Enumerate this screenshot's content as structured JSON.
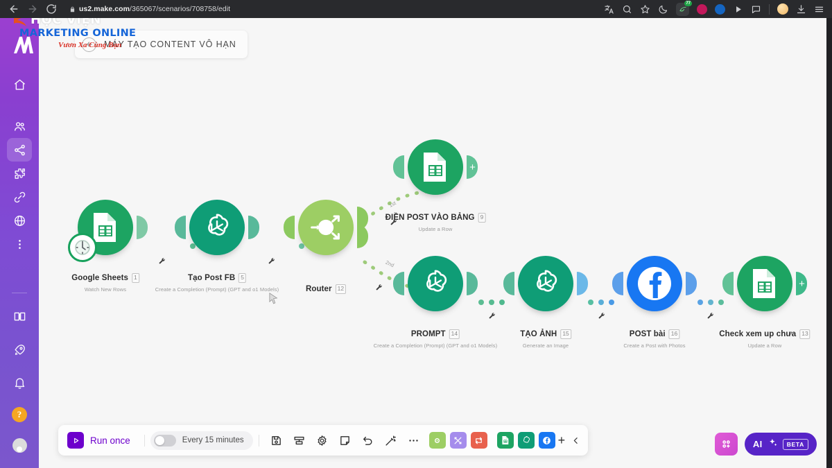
{
  "browser": {
    "url_host": "us2.make.com",
    "url_path": "/365067/scenarios/708758/edit",
    "icons": {
      "back": "back-arrow-icon",
      "forward": "forward-arrow-icon",
      "reload": "reload-icon",
      "lock": "lock-icon",
      "translate": "translate-icon",
      "zoom": "page-zoom-icon",
      "bookmark": "star-icon",
      "dark_mode": "moon-icon",
      "extension_green": "extension-green-icon",
      "extension_pink": "extension-pink-icon",
      "extension_blue": "extension-blue-icon",
      "media": "play-icon",
      "chat": "speech-bubble-icon",
      "profile": "profile-avatar-icon",
      "downloads": "download-icon",
      "menu": "hamburger-menu-icon"
    },
    "extension_badge": "77"
  },
  "watermark": {
    "line1": "HỌC VIỆN",
    "line2": "MARKETING ONLINE",
    "line3": "Vươn Xa Cùng Bạn"
  },
  "sidebar": {
    "items": [
      {
        "name": "home",
        "icon": "home-icon",
        "active": false
      },
      {
        "name": "team",
        "icon": "people-icon",
        "active": false
      },
      {
        "name": "scenarios",
        "icon": "share-nodes-icon",
        "active": true
      },
      {
        "name": "templates",
        "icon": "puzzle-icon",
        "active": false
      },
      {
        "name": "connections",
        "icon": "link-icon",
        "active": false
      },
      {
        "name": "webhooks",
        "icon": "globe-icon",
        "active": false
      },
      {
        "name": "more",
        "icon": "more-vertical-icon",
        "active": false
      }
    ],
    "bottom_items": [
      {
        "name": "docs",
        "icon": "book-icon"
      },
      {
        "name": "whats-new",
        "icon": "rocket-icon"
      },
      {
        "name": "notifications",
        "icon": "bell-icon"
      },
      {
        "name": "help",
        "icon": "question-mark-icon",
        "label": "?"
      },
      {
        "name": "account",
        "icon": "user-avatar-icon"
      }
    ]
  },
  "header": {
    "back_label": "back-arrow-icon",
    "scenario_title": "MÁY TẠO CONTENT VÔ HẠN"
  },
  "flow": {
    "modules": [
      {
        "id": "google-sheets",
        "name": "Google Sheets",
        "number": "1",
        "subtitle": "Watch New Rows",
        "app": "google-sheets",
        "color": "#1da462",
        "trigger": true,
        "trigger_icon": "clock-icon"
      },
      {
        "id": "tao-post-fb",
        "name": "Tạo Post FB",
        "number": "5",
        "subtitle": "Create a Completion (Prompt) (GPT and o1 Models)",
        "app": "openai",
        "color": "#0f9d76"
      },
      {
        "id": "router",
        "name": "Router",
        "number": "12",
        "subtitle": "",
        "app": "router",
        "color": "#9dce64"
      },
      {
        "id": "dien-post-vao-bang",
        "name": "ĐIỀN POST VÀO BẢNG",
        "number": "9",
        "subtitle": "Update a Row",
        "app": "google-sheets",
        "color": "#1da462"
      },
      {
        "id": "prompt",
        "name": "PROMPT",
        "number": "14",
        "subtitle": "Create a Completion (Prompt) (GPT and o1 Models)",
        "app": "openai",
        "color": "#0f9d76"
      },
      {
        "id": "tao-anh",
        "name": "TẠO ẢNH",
        "number": "15",
        "subtitle": "Generate an Image",
        "app": "openai",
        "color": "#0f9d76"
      },
      {
        "id": "post-bai",
        "name": "POST bài",
        "number": "16",
        "subtitle": "Create a Post with Photos",
        "app": "facebook",
        "color": "#1877f2"
      },
      {
        "id": "check-xem-up-chua",
        "name": "Check xem up chưa",
        "number": "13",
        "subtitle": "Update a Row",
        "app": "google-sheets",
        "color": "#1da462"
      }
    ],
    "routes": [
      {
        "label": "1st",
        "target": "dien-post-vao-bang"
      },
      {
        "label": "2nd",
        "target": "prompt"
      }
    ]
  },
  "toolbar": {
    "run_label": "Run once",
    "run_icon": "play-icon",
    "schedule_label": "Every 15 minutes",
    "schedule_enabled": false,
    "icons": [
      {
        "name": "save-icon"
      },
      {
        "name": "auto-align-icon"
      },
      {
        "name": "settings-gear-icon"
      },
      {
        "name": "notes-icon"
      },
      {
        "name": "undo-icon"
      },
      {
        "name": "magic-wand-icon"
      },
      {
        "name": "more-options-icon"
      }
    ],
    "app_buttons": [
      {
        "name": "router-tool-button",
        "color": "#9dce64",
        "icon": "router-icon"
      },
      {
        "name": "tools-button",
        "color": "#a58cec",
        "icon": "tools-icon"
      },
      {
        "name": "iterator-button",
        "color": "#e8614d",
        "icon": "repeat-icon"
      },
      {
        "name": "google-sheets-button",
        "color": "#1da462",
        "icon": "sheets-icon"
      },
      {
        "name": "openai-button",
        "color": "#0f9d76",
        "icon": "openai-icon"
      },
      {
        "name": "facebook-button",
        "color": "#1877f2",
        "icon": "facebook-icon"
      }
    ],
    "add_label": "+",
    "collapse_icon": "chevron-left-icon"
  },
  "right_tools": {
    "grid_button": "apps-grid-icon",
    "ai_label": "AI",
    "ai_sparkle": "sparkle-icon",
    "ai_badge": "BETA"
  }
}
